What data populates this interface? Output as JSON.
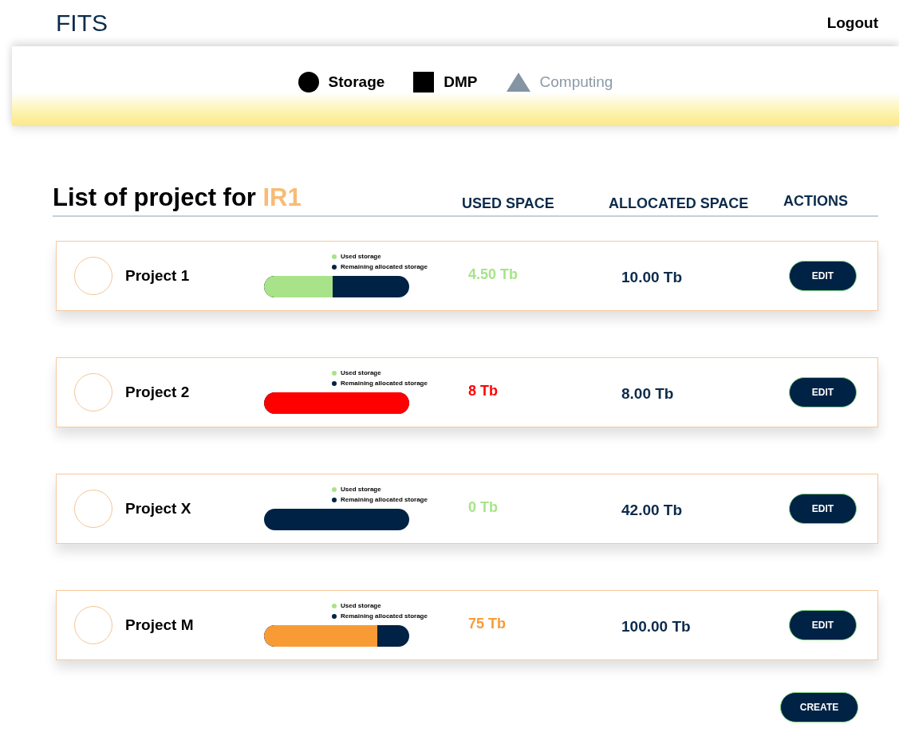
{
  "header": {
    "logo": "FITS",
    "logout": "Logout"
  },
  "tabs": [
    {
      "label": "Storage",
      "kind": "circle",
      "disabled": false
    },
    {
      "label": "DMP",
      "kind": "square",
      "disabled": false
    },
    {
      "label": "Computing",
      "kind": "triangle",
      "disabled": true
    }
  ],
  "title": {
    "text": "List of project for ",
    "highlight": "IR1"
  },
  "columns": [
    "USED SPACE",
    "ALLOCATED SPACE",
    "ACTIONS"
  ],
  "projects": [
    {
      "name": "Project 1",
      "legend": [
        {
          "label": "Used storage",
          "color": "#a8e38a"
        },
        {
          "label": "Remaining allocated storage",
          "color": "#002244"
        }
      ],
      "level": 0.47,
      "color": "#a8e38a",
      "used": "4.50 Tb",
      "allocated": "10.00 Tb",
      "action": "EDIT"
    },
    {
      "name": "Project 2",
      "legend": [
        {
          "label": "Used storage",
          "color": "#a8e38a"
        },
        {
          "label": "Remaining allocated storage",
          "color": "#002244"
        }
      ],
      "level": 1,
      "color": "#ff0000",
      "used": "8 Tb",
      "allocated": "8.00 Tb",
      "action": "EDIT"
    },
    {
      "name": "Project X",
      "legend": [
        {
          "label": "Used storage",
          "color": "#a8e38a"
        },
        {
          "label": "Remaining allocated storage",
          "color": "#002244"
        }
      ],
      "level": 0,
      "color": "#a8e38a",
      "used": "0 Tb",
      "allocated": "42.00 Tb",
      "action": "EDIT"
    },
    {
      "name": "Project M",
      "legend": [
        {
          "label": "Used storage",
          "color": "#a8e38a"
        },
        {
          "label": "Remaining allocated storage",
          "color": "#002244"
        }
      ],
      "level": 0.78,
      "color": "#f99b35",
      "used": "75 Tb",
      "allocated": "100.00 Tb",
      "action": "EDIT"
    }
  ],
  "create": "CREATE"
}
